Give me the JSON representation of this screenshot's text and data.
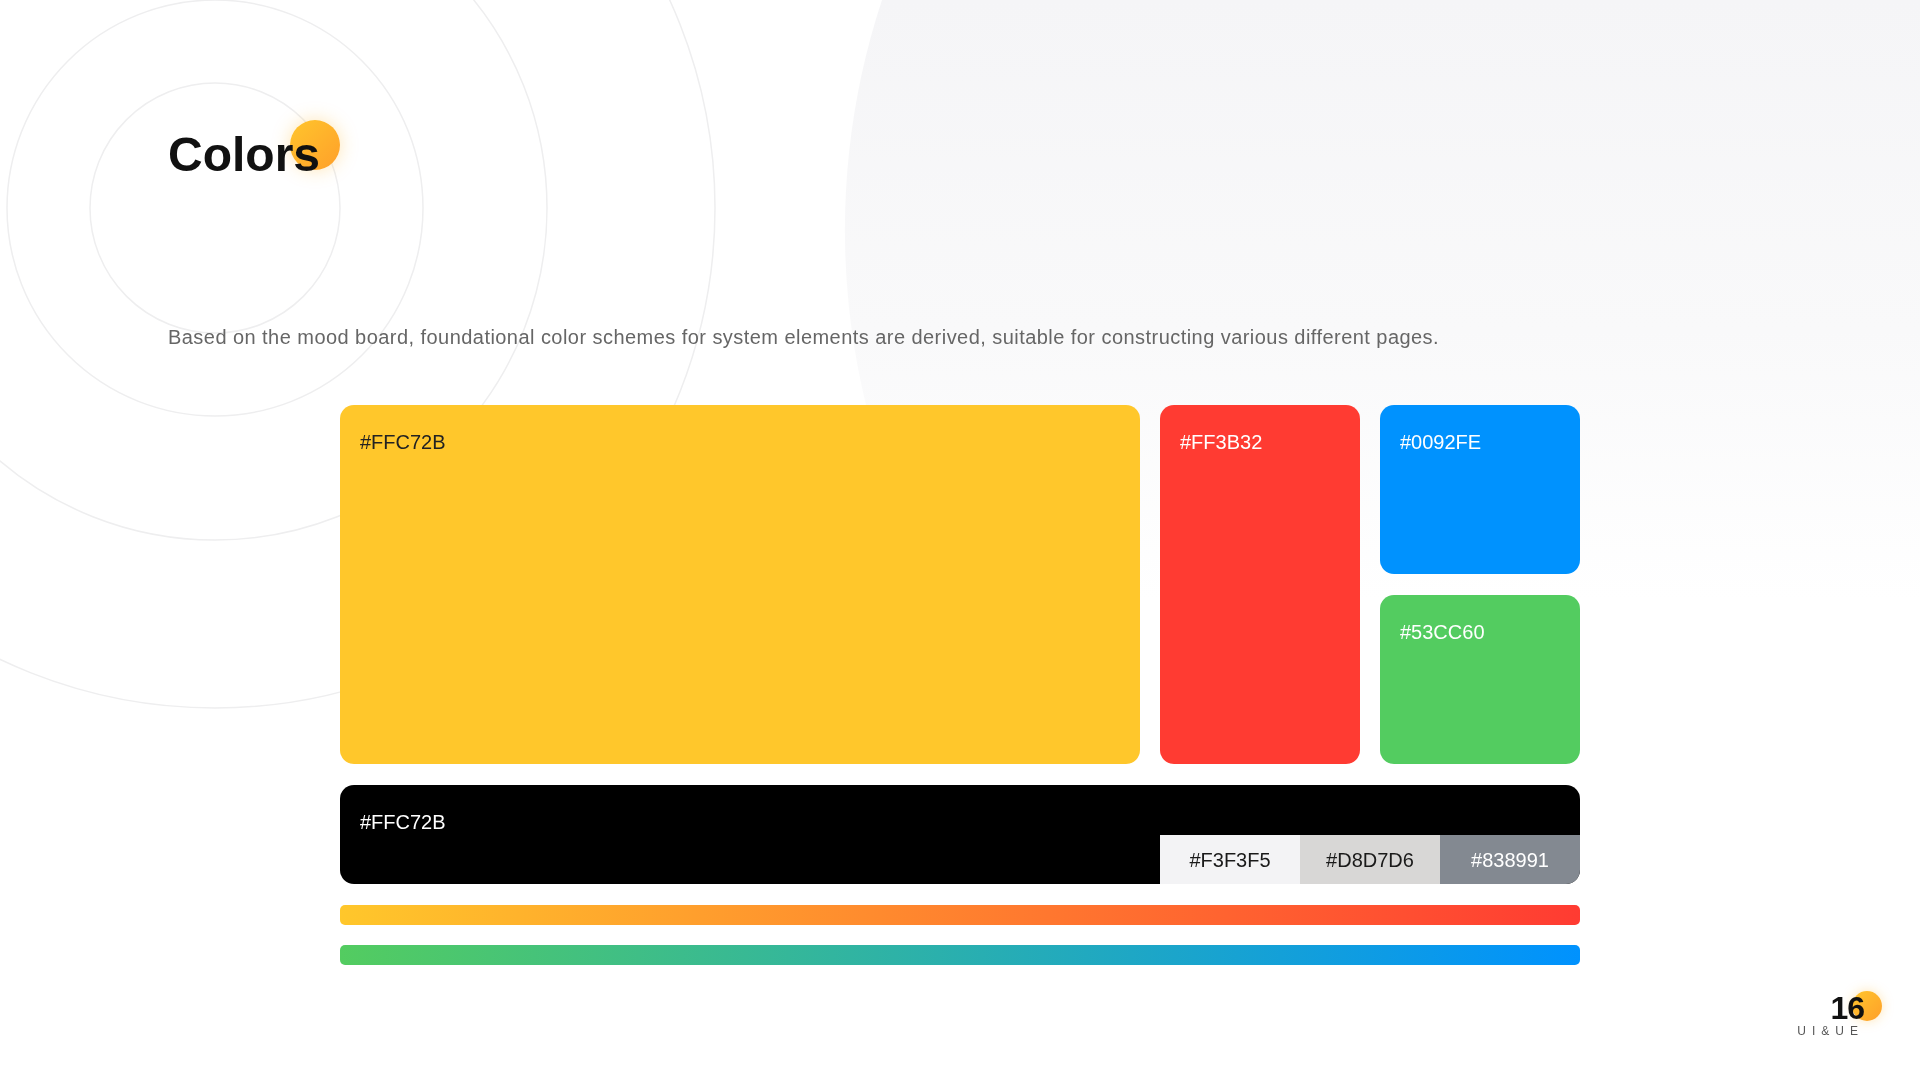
{
  "title": "Colors",
  "description": "Based on the mood board, foundational color schemes for system elements are derived, suitable for constructing various different pages.",
  "swatches": [
    {
      "label": "#FFC72B",
      "color": "#ffc72b"
    },
    {
      "label": "#FF3B32",
      "color": "#ff3b32"
    },
    {
      "label": "#0092FE",
      "color": "#0092fe"
    },
    {
      "label": "#53CC60",
      "color": "#53cc60"
    }
  ],
  "dark_bar": {
    "label": "#FFC72B",
    "shades": [
      {
        "label": "#F3F3F5",
        "color": "#f3f3f5"
      },
      {
        "label": "#D8D7D6",
        "color": "#d8d7d6"
      },
      {
        "label": "#838991",
        "color": "#838991"
      }
    ]
  },
  "gradients": [
    {
      "stops": [
        {
          "color": "#ffc72b"
        },
        {
          "color": "#ff3b32"
        }
      ]
    },
    {
      "stops": [
        {
          "color": "#53cc60"
        },
        {
          "color": "#0092fe"
        }
      ]
    }
  ],
  "page": {
    "number": "16",
    "caption": "UI&UE"
  }
}
